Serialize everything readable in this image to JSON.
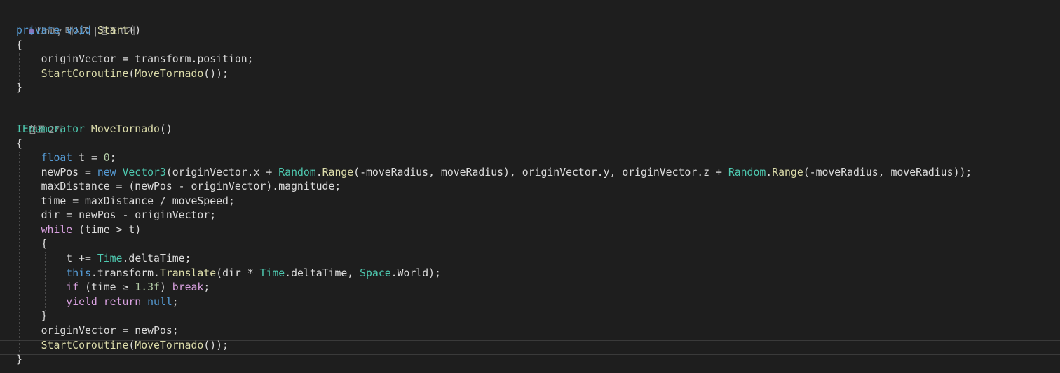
{
  "codelens": {
    "start_hint": "Unity 메시지 | 참조 0개",
    "move_tornado_hint": "참조 2개"
  },
  "icons": {
    "unity": "unity-message-icon"
  },
  "colors": {
    "background": "#1e1e1e",
    "keyword": "#569cd6",
    "control": "#d8a0df",
    "type": "#4ec9b0",
    "method": "#dcdcaa",
    "text": "#dcdcdc",
    "number": "#b5cea8"
  },
  "code": {
    "l_start_decl": [
      [
        "kw",
        "private"
      ],
      [
        "punc",
        " "
      ],
      [
        "kw",
        "void"
      ],
      [
        "punc",
        " "
      ],
      [
        "method",
        "Start"
      ],
      [
        "punc",
        "()"
      ]
    ],
    "l_open1": [
      [
        "punc",
        "{"
      ]
    ],
    "l_origin_assign": [
      [
        "punc",
        "    "
      ],
      [
        "var",
        "originVector"
      ],
      [
        "punc",
        " = "
      ],
      [
        "var",
        "transform"
      ],
      [
        "punc",
        "."
      ],
      [
        "var",
        "position"
      ],
      [
        "punc",
        ";"
      ]
    ],
    "l_start_coroutine1": [
      [
        "punc",
        "    "
      ],
      [
        "method",
        "StartCoroutine"
      ],
      [
        "punc",
        "("
      ],
      [
        "method",
        "MoveTornado"
      ],
      [
        "punc",
        "());"
      ]
    ],
    "l_close1": [
      [
        "punc",
        "}"
      ]
    ],
    "l_move_decl": [
      [
        "type",
        "IEnumerator"
      ],
      [
        "punc",
        " "
      ],
      [
        "method",
        "MoveTornado"
      ],
      [
        "punc",
        "()"
      ]
    ],
    "l_open2": [
      [
        "punc",
        "{"
      ]
    ],
    "l_float_t": [
      [
        "punc",
        "    "
      ],
      [
        "kw",
        "float"
      ],
      [
        "punc",
        " "
      ],
      [
        "var",
        "t"
      ],
      [
        "punc",
        " = "
      ],
      [
        "num",
        "0"
      ],
      [
        "punc",
        ";"
      ]
    ],
    "l_newpos": [
      [
        "punc",
        "    "
      ],
      [
        "var",
        "newPos"
      ],
      [
        "punc",
        " = "
      ],
      [
        "kw",
        "new"
      ],
      [
        "punc",
        " "
      ],
      [
        "type",
        "Vector3"
      ],
      [
        "punc",
        "("
      ],
      [
        "var",
        "originVector"
      ],
      [
        "punc",
        "."
      ],
      [
        "var",
        "x"
      ],
      [
        "punc",
        " + "
      ],
      [
        "type",
        "Random"
      ],
      [
        "punc",
        "."
      ],
      [
        "method",
        "Range"
      ],
      [
        "punc",
        "(-"
      ],
      [
        "var",
        "moveRadius"
      ],
      [
        "punc",
        ", "
      ],
      [
        "var",
        "moveRadius"
      ],
      [
        "punc",
        "), "
      ],
      [
        "var",
        "originVector"
      ],
      [
        "punc",
        "."
      ],
      [
        "var",
        "y"
      ],
      [
        "punc",
        ", "
      ],
      [
        "var",
        "originVector"
      ],
      [
        "punc",
        "."
      ],
      [
        "var",
        "z"
      ],
      [
        "punc",
        " + "
      ],
      [
        "type",
        "Random"
      ],
      [
        "punc",
        "."
      ],
      [
        "method",
        "Range"
      ],
      [
        "punc",
        "(-"
      ],
      [
        "var",
        "moveRadius"
      ],
      [
        "punc",
        ", "
      ],
      [
        "var",
        "moveRadius"
      ],
      [
        "punc",
        "));"
      ]
    ],
    "l_maxdist": [
      [
        "punc",
        "    "
      ],
      [
        "var",
        "maxDistance"
      ],
      [
        "punc",
        " = ("
      ],
      [
        "var",
        "newPos"
      ],
      [
        "punc",
        " - "
      ],
      [
        "var",
        "originVector"
      ],
      [
        "punc",
        ")."
      ],
      [
        "var",
        "magnitude"
      ],
      [
        "punc",
        ";"
      ]
    ],
    "l_time": [
      [
        "punc",
        "    "
      ],
      [
        "var",
        "time"
      ],
      [
        "punc",
        " = "
      ],
      [
        "var",
        "maxDistance"
      ],
      [
        "punc",
        " / "
      ],
      [
        "var",
        "moveSpeed"
      ],
      [
        "punc",
        ";"
      ]
    ],
    "l_dir": [
      [
        "punc",
        "    "
      ],
      [
        "var",
        "dir"
      ],
      [
        "punc",
        " = "
      ],
      [
        "var",
        "newPos"
      ],
      [
        "punc",
        " - "
      ],
      [
        "var",
        "originVector"
      ],
      [
        "punc",
        ";"
      ]
    ],
    "l_while": [
      [
        "punc",
        "    "
      ],
      [
        "ctrl",
        "while"
      ],
      [
        "punc",
        " ("
      ],
      [
        "var",
        "time"
      ],
      [
        "punc",
        " > "
      ],
      [
        "var",
        "t"
      ],
      [
        "punc",
        ")"
      ]
    ],
    "l_open3": [
      [
        "punc",
        "    {"
      ]
    ],
    "l_t_inc": [
      [
        "punc",
        "        "
      ],
      [
        "var",
        "t"
      ],
      [
        "punc",
        " += "
      ],
      [
        "type",
        "Time"
      ],
      [
        "punc",
        "."
      ],
      [
        "var",
        "deltaTime"
      ],
      [
        "punc",
        ";"
      ]
    ],
    "l_translate": [
      [
        "punc",
        "        "
      ],
      [
        "kw",
        "this"
      ],
      [
        "punc",
        "."
      ],
      [
        "var",
        "transform"
      ],
      [
        "punc",
        "."
      ],
      [
        "method",
        "Translate"
      ],
      [
        "punc",
        "("
      ],
      [
        "var",
        "dir"
      ],
      [
        "punc",
        " * "
      ],
      [
        "type",
        "Time"
      ],
      [
        "punc",
        "."
      ],
      [
        "var",
        "deltaTime"
      ],
      [
        "punc",
        ", "
      ],
      [
        "type",
        "Space"
      ],
      [
        "punc",
        "."
      ],
      [
        "var",
        "World"
      ],
      [
        "punc",
        ");"
      ]
    ],
    "l_if_break": [
      [
        "punc",
        "        "
      ],
      [
        "ctrl",
        "if"
      ],
      [
        "punc",
        " ("
      ],
      [
        "var",
        "time"
      ],
      [
        "punc",
        " ≥ "
      ],
      [
        "num",
        "1.3f"
      ],
      [
        "punc",
        ") "
      ],
      [
        "ctrl",
        "break"
      ],
      [
        "punc",
        ";"
      ]
    ],
    "l_yield": [
      [
        "punc",
        "        "
      ],
      [
        "ctrl",
        "yield"
      ],
      [
        "punc",
        " "
      ],
      [
        "ctrl",
        "return"
      ],
      [
        "punc",
        " "
      ],
      [
        "kw",
        "null"
      ],
      [
        "punc",
        ";"
      ]
    ],
    "l_close3": [
      [
        "punc",
        "    }"
      ]
    ],
    "l_origin_update": [
      [
        "punc",
        "    "
      ],
      [
        "var",
        "originVector"
      ],
      [
        "punc",
        " = "
      ],
      [
        "var",
        "newPos"
      ],
      [
        "punc",
        ";"
      ]
    ],
    "l_start_coroutine2": [
      [
        "punc",
        "    "
      ],
      [
        "method",
        "StartCoroutine"
      ],
      [
        "punc",
        "("
      ],
      [
        "method",
        "MoveTornado"
      ],
      [
        "punc",
        "());"
      ]
    ],
    "l_close2": [
      [
        "punc",
        "}"
      ]
    ]
  }
}
